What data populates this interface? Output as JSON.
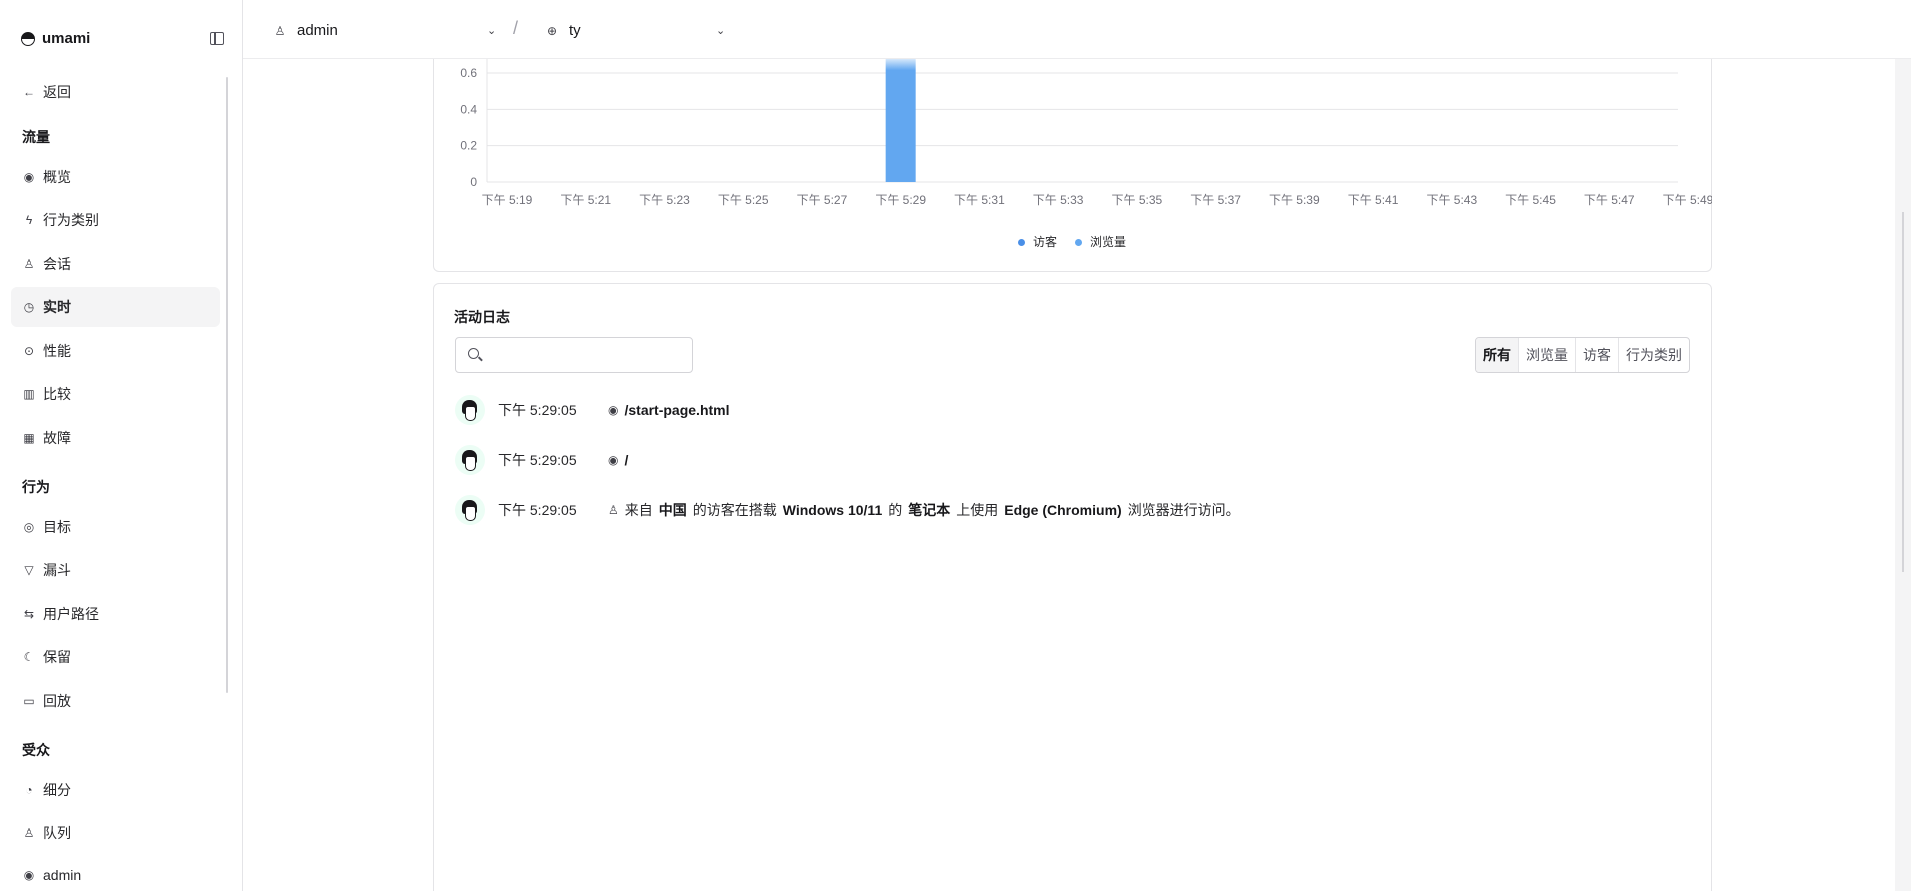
{
  "sidebar": {
    "brand": "umami",
    "back": "返回",
    "sections": {
      "traffic": "流量",
      "behavior": "行为",
      "audience": "受众"
    },
    "items": {
      "overview": "概览",
      "events": "行为类别",
      "sessions": "会话",
      "realtime": "实时",
      "performance": "性能",
      "compare": "比较",
      "breakdown": "故障",
      "goals": "目标",
      "funnel": "漏斗",
      "journey": "用户路径",
      "retention": "保留",
      "replay": "回放",
      "segments": "细分",
      "cohorts": "队列"
    },
    "user": "admin"
  },
  "topbar": {
    "user": "admin",
    "website": "ty"
  },
  "chart_data": {
    "type": "bar",
    "x_ticks": [
      "下午 5:19",
      "下午 5:21",
      "下午 5:23",
      "下午 5:25",
      "下午 5:27",
      "下午 5:29",
      "下午 5:31",
      "下午 5:33",
      "下午 5:35",
      "下午 5:37",
      "下午 5:39",
      "下午 5:41",
      "下午 5:43",
      "下午 5:45",
      "下午 5:47",
      "下午 5:49"
    ],
    "y_ticks": [
      "0",
      "0.2",
      "0.4",
      "0.6"
    ],
    "series": [
      {
        "name": "访客",
        "color": "#4a8fe7"
      },
      {
        "name": "浏览量",
        "color": "#62a7f0"
      }
    ],
    "bars": [
      {
        "x": "下午 5:29",
        "series": "浏览量",
        "value": 1
      }
    ],
    "ylim_visible": [
      0,
      0.6
    ]
  },
  "activity": {
    "title": "活动日志",
    "search_placeholder": "",
    "filters": [
      "所有",
      "浏览量",
      "访客",
      "行为类别"
    ],
    "rows": [
      {
        "time": "下午 5:29:05",
        "path": "/start-page.html"
      },
      {
        "time": "下午 5:29:05",
        "path": "/"
      },
      {
        "time": "下午 5:29:05",
        "p1": "来自",
        "country": "中国",
        "p2": "的访客在搭载",
        "os": "Windows 10/11",
        "p3": "的",
        "device": "笔记本",
        "p4": "上使用",
        "browser": "Edge (Chromium)",
        "p5": "浏览器进行访问。"
      }
    ]
  }
}
